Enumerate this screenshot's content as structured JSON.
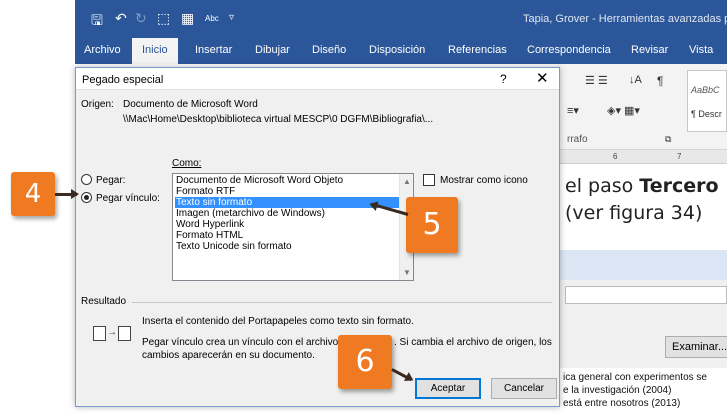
{
  "word": {
    "title": "Tapia, Grover - Herramientas avanzadas para",
    "quick_access": {
      "abc_label": "Abc"
    },
    "tabs": [
      "Archivo",
      "Inicio",
      "Insertar",
      "Dibujar",
      "Diseño",
      "Disposición",
      "Referencias",
      "Correspondencia",
      "Revisar",
      "Vista"
    ],
    "active_tab": "Inicio",
    "ribbon": {
      "group_label": "rrafo",
      "style_preview": "AaBbC",
      "style_name": "¶ Descr",
      "pilcrow": "¶",
      "ruler_marks": [
        "6",
        "7"
      ]
    },
    "document": {
      "line1_prefix": "el paso ",
      "line1_bold": "Tercero",
      "line2": "(ver figura 34)"
    },
    "back_dialog": {
      "browse_button": "Examinar...",
      "bibliography": [
        "ica general con experimentos se",
        "e la investigación (2004)",
        "está entre nosotros (2013)"
      ]
    }
  },
  "dialog": {
    "title": "Pegado especial",
    "help": "?",
    "close": "✕",
    "origin_label": "Origen:",
    "origin_value": "Documento de Microsoft Word",
    "origin_path": "\\\\Mac\\Home\\Desktop\\biblioteca virtual MESCP\\0 DGFM\\Bibliografia\\...",
    "como_label": "Como:",
    "radio_paste": "Pegar:",
    "radio_paste_link": "Pegar vínculo:",
    "selected_radio": "paste_link",
    "formats": [
      "Documento de Microsoft Word Objeto",
      "Formato RTF",
      "Texto sin formato",
      "Imagen (metarchivo de Windows)",
      "Word Hyperlink",
      "Formato HTML",
      "Texto Unicode sin formato"
    ],
    "selected_format_index": 2,
    "show_as_icon": "Mostrar como icono",
    "show_as_icon_checked": false,
    "result_label": "Resultado",
    "result_line1": "Inserta el contenido del Portapapeles como texto sin formato.",
    "result_line2a": "Pegar vínculo crea un vínculo con el archivo",
    "result_line2b": ". Si cambia el archivo de origen, los",
    "result_line3": "cambios aparecerán en su documento.",
    "ok_button": "Aceptar",
    "cancel_button": "Cancelar"
  },
  "steps": {
    "badge4": "4",
    "badge5": "5",
    "badge6": "6"
  },
  "colors": {
    "word_blue": "#2b579a",
    "badge_orange": "#f07a22",
    "selection_blue": "#3390ff"
  },
  "icons": [
    "save-icon",
    "undo-icon",
    "redo-icon",
    "format-painter-icon",
    "spelling-icon",
    "help-icon",
    "close-icon",
    "scroll-up-icon",
    "scroll-down-icon",
    "link-icon",
    "document-icon",
    "arrow-right-icon"
  ]
}
